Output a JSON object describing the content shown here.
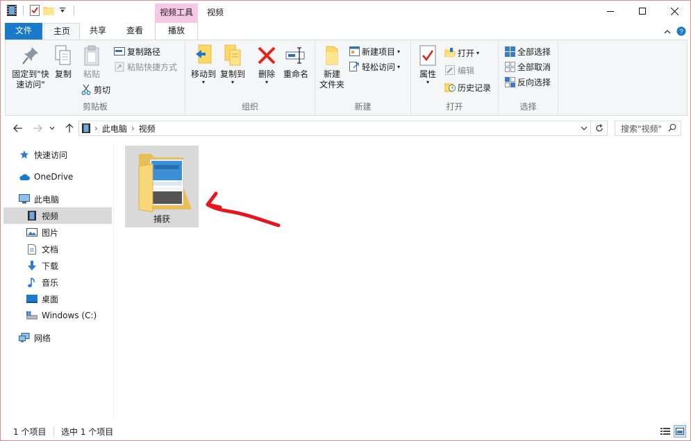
{
  "window": {
    "title": "视频",
    "contextual_tab_header": "视频工具",
    "controls": {
      "minimize": "─",
      "maximize": "☐",
      "close": "✕"
    }
  },
  "tabs": {
    "file": "文件",
    "home": "主页",
    "share": "共享",
    "view": "查看",
    "play": "播放"
  },
  "ribbon": {
    "clipboard": {
      "label": "剪贴板",
      "pin_line1": "固定到\"快",
      "pin_line2": "速访问\"",
      "copy": "复制",
      "paste": "粘贴",
      "copy_path": "复制路径",
      "paste_shortcut": "粘贴快捷方式",
      "cut": "剪切"
    },
    "organize": {
      "label": "组织",
      "move_to": "移动到",
      "copy_to": "复制到",
      "delete": "删除",
      "rename": "重命名"
    },
    "new": {
      "label": "新建",
      "new_folder_line1": "新建",
      "new_folder_line2": "文件夹",
      "new_item": "新建项目",
      "easy_access": "轻松访问"
    },
    "open": {
      "label": "打开",
      "properties": "属性",
      "open": "打开",
      "edit": "编辑",
      "history": "历史记录"
    },
    "select": {
      "label": "选择",
      "select_all": "全部选择",
      "select_none": "全部取消",
      "invert": "反向选择"
    }
  },
  "address": {
    "crumbs": [
      "此电脑",
      "视频"
    ],
    "search_placeholder": "搜索\"视频\""
  },
  "sidebar": {
    "items": [
      {
        "label": "快速访问",
        "icon": "star-icon"
      },
      {
        "label": "OneDrive",
        "icon": "cloud-icon"
      },
      {
        "label": "此电脑",
        "icon": "computer-icon"
      },
      {
        "label": "视频",
        "icon": "video-icon"
      },
      {
        "label": "图片",
        "icon": "picture-icon"
      },
      {
        "label": "文档",
        "icon": "document-icon"
      },
      {
        "label": "下载",
        "icon": "download-icon"
      },
      {
        "label": "音乐",
        "icon": "music-icon"
      },
      {
        "label": "桌面",
        "icon": "desktop-icon"
      },
      {
        "label": "Windows (C:)",
        "icon": "drive-icon"
      },
      {
        "label": "网络",
        "icon": "network-icon"
      }
    ]
  },
  "content": {
    "items": [
      {
        "name": "捕获",
        "type": "folder",
        "selected": true
      }
    ]
  },
  "status": {
    "count": "1 个项目",
    "selected": "选中 1 个项目"
  },
  "colors": {
    "accent": "#1979ca",
    "context_tab": "#f6c8e4",
    "selection": "#d9d9d9",
    "annotation_arrow": "#e8141e"
  }
}
